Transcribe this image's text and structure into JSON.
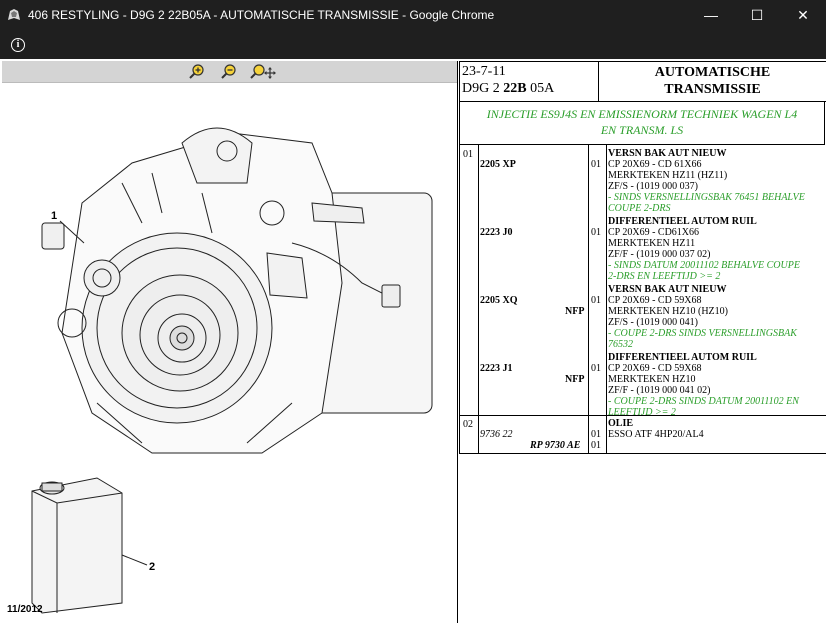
{
  "window": {
    "title": "406 RESTYLING - D9G 2 22B05A - AUTOMATISCHE TRANSMISSIE - Google Chrome",
    "minimize": "—",
    "maximize": "☐",
    "close": "✕"
  },
  "address_bar": {
    "info_icon": "i"
  },
  "viewer": {
    "tools": [
      "zoom-in-icon",
      "zoom-out-icon",
      "zoom-pan-icon"
    ],
    "callouts": [
      "1",
      "2"
    ],
    "date_stamp": "11/2012"
  },
  "sheet": {
    "date": "23-7-11",
    "code_prefix": "D9G 2 ",
    "code_bold": "22B",
    "code_suffix": " 05A",
    "title_line1": "AUTOMATISCHE",
    "title_line2": "TRANSMISSIE",
    "note_line1": "INJECTIE ES9J4S EN EMISSIENORM TECHNIEK WAGEN L4",
    "note_line2": "EN TRANSM. LS"
  },
  "parts": [
    {
      "ref": "01",
      "number": "2205 XP",
      "nfp": "",
      "qty": "01",
      "name": "VERSN BAK AUT NIEUW",
      "lines": [
        "CP 20X69 - CD 61X66",
        "MERKTEKEN HZ11 (HZ11)",
        "ZF/S - (1019 000 037)"
      ],
      "notes": [
        "- SINDS VERSNELLINGSBAK 76451 BEHALVE",
        "COUPE 2-DRS"
      ]
    },
    {
      "ref": "",
      "number": "2223 J0",
      "nfp": "",
      "qty": "01",
      "name": "DIFFERENTIEEL AUTOM RUIL",
      "lines": [
        "CP 20X69 - CD61X66",
        "MERKTEKEN HZ11",
        "ZF/F - (1019 000 037 02)"
      ],
      "notes": [
        "- SINDS DATUM 20011102 BEHALVE COUPE",
        "2-DRS EN LEEFTIJD >= 2"
      ]
    },
    {
      "ref": "",
      "number": "2205 XQ",
      "nfp": "NFP",
      "qty": "01",
      "name": "VERSN BAK AUT NIEUW",
      "lines": [
        "CP 20X69 - CD 59X68",
        "MERKTEKEN HZ10 (HZ10)",
        "ZF/S - (1019 000 041)"
      ],
      "notes": [
        "- COUPE 2-DRS SINDS VERSNELLINGSBAK",
        "76532"
      ]
    },
    {
      "ref": "",
      "number": "2223 J1",
      "nfp": "NFP",
      "qty": "01",
      "name": "DIFFERENTIEEL AUTOM RUIL",
      "lines": [
        "CP 20X69 - CD 59X68",
        "MERKTEKEN HZ10",
        "ZF/F - (1019 000 041 02)"
      ],
      "notes": [
        "- COUPE 2-DRS SINDS DATUM 20011102 EN",
        "LEEFTIJD >= 2"
      ]
    }
  ],
  "oil": {
    "ref": "02",
    "number": "9736 22",
    "rp": "RP 9730 AE",
    "qty1": "01",
    "qty2": "01",
    "name": "OLIE",
    "desc": "ESSO ATF 4HP20/AL4"
  }
}
